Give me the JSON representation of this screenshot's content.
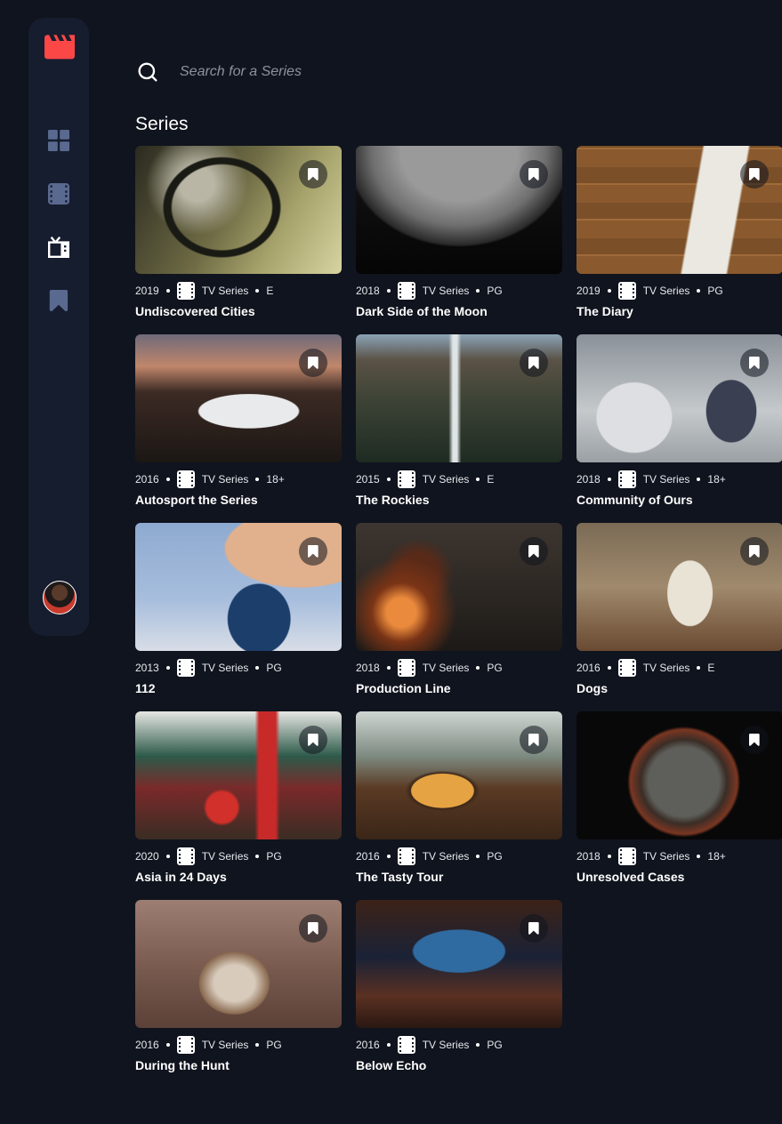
{
  "sidebar": {
    "logo": "clapperboard-icon",
    "nav": [
      {
        "name": "home-grid-icon",
        "active": false
      },
      {
        "name": "movies-film-icon",
        "active": false
      },
      {
        "name": "tv-series-icon",
        "active": true
      },
      {
        "name": "bookmark-icon",
        "active": false
      }
    ],
    "avatar": "user-avatar"
  },
  "search": {
    "placeholder": "Search for a Series"
  },
  "section": {
    "title": "Series"
  },
  "colors": {
    "accent": "#fc4747",
    "background": "#10141e",
    "sidebar": "#161d2f",
    "nav_inactive": "#5a698f"
  },
  "items": [
    {
      "year": "2019",
      "category": "TV Series",
      "rating": "E",
      "title": "Undiscovered Cities",
      "bookmarked": false
    },
    {
      "year": "2018",
      "category": "TV Series",
      "rating": "PG",
      "title": "Dark Side of the Moon",
      "bookmarked": false
    },
    {
      "year": "2019",
      "category": "TV Series",
      "rating": "PG",
      "title": "The Diary",
      "bookmarked": false
    },
    {
      "year": "2016",
      "category": "TV Series",
      "rating": "18+",
      "title": "Autosport the Series",
      "bookmarked": false
    },
    {
      "year": "2015",
      "category": "TV Series",
      "rating": "E",
      "title": "The Rockies",
      "bookmarked": false
    },
    {
      "year": "2018",
      "category": "TV Series",
      "rating": "18+",
      "title": "Community of Ours",
      "bookmarked": false
    },
    {
      "year": "2013",
      "category": "TV Series",
      "rating": "PG",
      "title": "112",
      "bookmarked": false
    },
    {
      "year": "2018",
      "category": "TV Series",
      "rating": "PG",
      "title": "Production Line",
      "bookmarked": false
    },
    {
      "year": "2016",
      "category": "TV Series",
      "rating": "E",
      "title": "Dogs",
      "bookmarked": false
    },
    {
      "year": "2020",
      "category": "TV Series",
      "rating": "PG",
      "title": "Asia in 24 Days",
      "bookmarked": false
    },
    {
      "year": "2016",
      "category": "TV Series",
      "rating": "PG",
      "title": "The Tasty Tour",
      "bookmarked": false
    },
    {
      "year": "2018",
      "category": "TV Series",
      "rating": "18+",
      "title": "Unresolved Cases",
      "bookmarked": false
    },
    {
      "year": "2016",
      "category": "TV Series",
      "rating": "PG",
      "title": "During the Hunt",
      "bookmarked": false
    },
    {
      "year": "2016",
      "category": "TV Series",
      "rating": "PG",
      "title": "Below Echo",
      "bookmarked": false
    }
  ]
}
